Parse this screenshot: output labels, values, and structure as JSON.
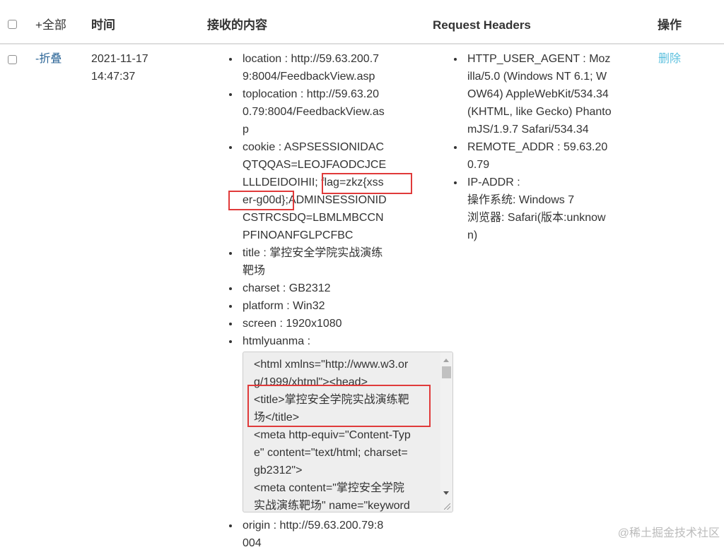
{
  "table": {
    "headers": {
      "expand_all": "+全部",
      "time": "时间",
      "content": "接收的内容",
      "request_headers": "Request Headers",
      "actions": "操作"
    },
    "row": {
      "collapse": "-折叠",
      "date": "2021-11-17",
      "clock": "14:47:37",
      "delete": "删除",
      "content_items": [
        {
          "label": "location",
          "lines": [
            "location : http://59.63.200.7",
            "9:8004/FeedbackView.asp"
          ]
        },
        {
          "label": "toplocation",
          "lines": [
            "toplocation : http://59.63.20",
            "0.79:8004/FeedbackView.as",
            "p"
          ]
        },
        {
          "label": "cookie",
          "lines": [
            "cookie : ASPSESSIONIDAC",
            "QTQQAS=LEOJFAODCJCE",
            "LLLDEIDOIHII; flag=zkz{xss",
            "er-g00d};ADMINSESSIONID",
            "CSTRCSDQ=LBMLMBCCN",
            "PFINOANFGLPCFBC"
          ]
        },
        {
          "label": "title",
          "lines": [
            "title : 掌控安全学院实战演练",
            "靶场"
          ]
        },
        {
          "label": "charset",
          "lines": [
            "charset : GB2312"
          ]
        },
        {
          "label": "platform",
          "lines": [
            "platform : Win32"
          ]
        },
        {
          "label": "screen",
          "lines": [
            "screen : 1920x1080"
          ]
        },
        {
          "label": "htmlyuanma",
          "lines": [
            "htmlyuanma :"
          ]
        }
      ],
      "htmlyuanma_lines": [
        "<html xmlns=\"http://www.w3.or",
        "g/1999/xhtml\"><head>",
        "<title>掌控安全学院实战演练靶",
        "场</title>",
        "<meta http-equiv=\"Content-Typ",
        "e\" content=\"text/html; charset=",
        "gb2312\">",
        "<meta content=\"掌控安全学院",
        "实战演练靶场\" name=\"keyword"
      ],
      "origin_lines": [
        "origin : http://59.63.200.79:8",
        "004"
      ],
      "header_items": [
        {
          "label": "HTTP_USER_AGENT",
          "lines": [
            "HTTP_USER_AGENT : Moz",
            "illa/5.0 (Windows NT 6.1; W",
            "OW64) AppleWebKit/534.34",
            "(KHTML, like Gecko) Phanto",
            "mJS/1.9.7 Safari/534.34"
          ]
        },
        {
          "label": "REMOTE_ADDR",
          "lines": [
            "REMOTE_ADDR : 59.63.20",
            "0.79"
          ]
        },
        {
          "label": "IP-ADDR",
          "lines": [
            "IP-ADDR :",
            "操作系统:  Windows 7",
            "浏览器:  Safari(版本:unknow",
            "n)"
          ]
        }
      ]
    }
  },
  "watermark": "@稀土掘金技术社区",
  "colors": {
    "link_teal": "#5bc0de",
    "link_dark": "#2a6496",
    "highlight_red": "#e03a3a"
  }
}
